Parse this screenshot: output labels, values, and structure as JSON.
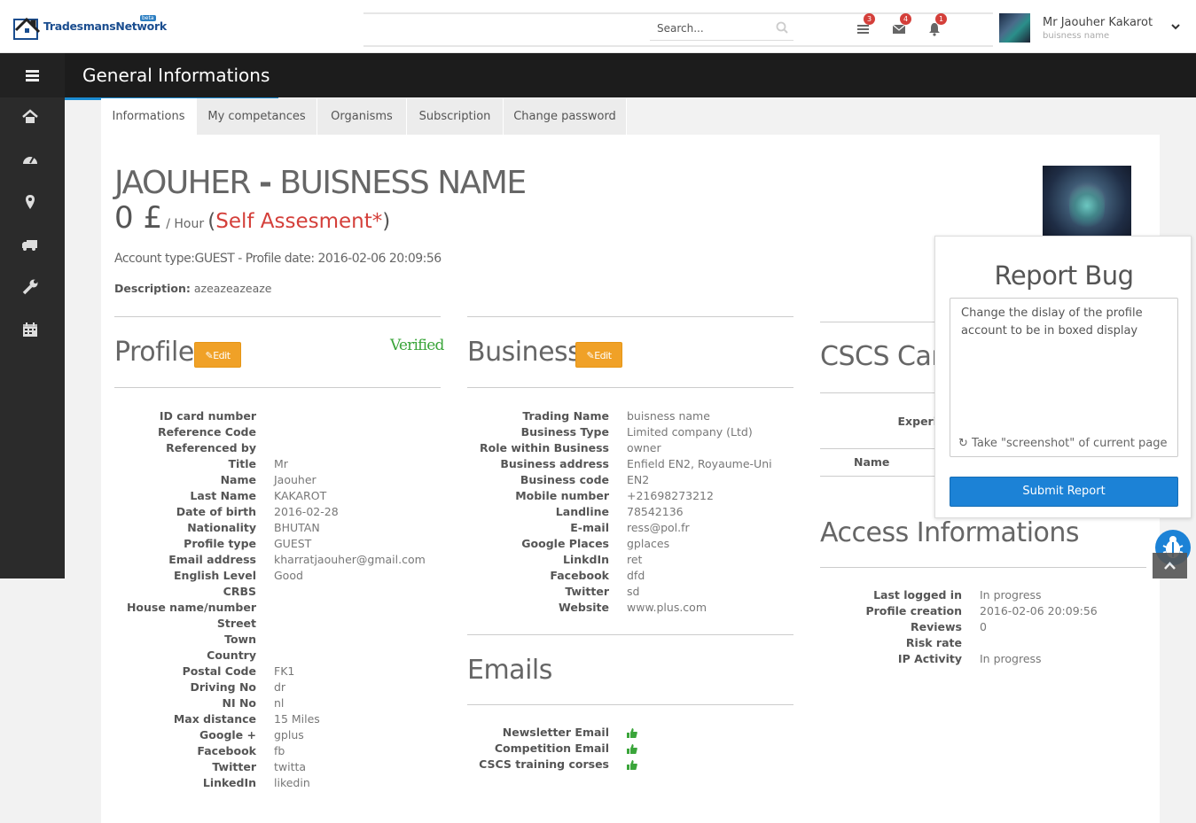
{
  "header": {
    "logo_text": "TradesmansNetwork",
    "logo_badge": "beta",
    "search_placeholder": "Search...",
    "badges": {
      "list": "3",
      "mail": "4",
      "bell": "1"
    },
    "user_name": "Mr Jaouher Kakarot",
    "user_sub": "buisness name"
  },
  "titlebar": {
    "title": "General Informations"
  },
  "sidebar": {
    "items": [
      "home-icon",
      "dashboard-icon",
      "map-marker-icon",
      "truck-icon",
      "wrench-icon",
      "calendar-icon"
    ]
  },
  "tabs": [
    "Informations",
    "My competances",
    "Organisms",
    "Subscription",
    "Change password"
  ],
  "summary": {
    "name_first": "JAOUHER",
    "name_sep": "-",
    "name_business": "BUISNESS NAME",
    "price_value": "0 £",
    "price_unit": "/ Hour",
    "price_open": "(",
    "price_note": "Self Assesment*",
    "price_close": ")",
    "account_line": "Account type:GUEST - Profile date: 2016-02-06 20:09:56",
    "desc_label": "Description:",
    "desc_value": "azeazeazeaze"
  },
  "profile": {
    "title": "Profile",
    "edit": "Edit",
    "verified": "Verified",
    "rows": [
      {
        "label": "ID card number",
        "value": ""
      },
      {
        "label": "Reference Code",
        "value": ""
      },
      {
        "label": "Referenced by",
        "value": ""
      },
      {
        "label": "Title",
        "value": "Mr"
      },
      {
        "label": "Name",
        "value": "Jaouher"
      },
      {
        "label": "Last Name",
        "value": "KAKAROT"
      },
      {
        "label": "Date of birth",
        "value": "2016-02-28"
      },
      {
        "label": "Nationality",
        "value": "BHUTAN"
      },
      {
        "label": "Profile type",
        "value": "GUEST"
      },
      {
        "label": "Email address",
        "value": "kharratjaouher@gmail.com"
      },
      {
        "label": "English Level",
        "value": "Good"
      },
      {
        "label": "CRBS",
        "value": ""
      },
      {
        "label": "House name/number",
        "value": ""
      },
      {
        "label": "Street",
        "value": ""
      },
      {
        "label": "Town",
        "value": ""
      },
      {
        "label": "Country",
        "value": ""
      },
      {
        "label": "Postal Code",
        "value": "FK1"
      },
      {
        "label": "Driving No",
        "value": "dr"
      },
      {
        "label": "NI No",
        "value": "nl"
      },
      {
        "label": "Max distance",
        "value": "15 Miles"
      },
      {
        "label": "Google +",
        "value": "gplus"
      },
      {
        "label": "Facebook",
        "value": "fb"
      },
      {
        "label": "Twitter",
        "value": "twitta"
      },
      {
        "label": "LinkedIn",
        "value": "likedin"
      }
    ]
  },
  "business": {
    "title": "Business",
    "edit": "Edit",
    "rows": [
      {
        "label": "Trading Name",
        "value": "buisness name"
      },
      {
        "label": "Business Type",
        "value": "Limited company (Ltd)"
      },
      {
        "label": "Role within Business",
        "value": "owner"
      },
      {
        "label": "Business address",
        "value": "Enfield EN2, Royaume-Uni"
      },
      {
        "label": "Business code",
        "value": "EN2"
      },
      {
        "label": "Mobile number",
        "value": "+21698273212"
      },
      {
        "label": "Landline",
        "value": "78542136"
      },
      {
        "label": "E-mail",
        "value": "ress@pol.fr"
      },
      {
        "label": "Google Places",
        "value": "gplaces"
      },
      {
        "label": "LinkdIn",
        "value": "ret"
      },
      {
        "label": "Facebook",
        "value": "dfd"
      },
      {
        "label": "Twitter",
        "value": "sd"
      },
      {
        "label": "Website",
        "value": "www.plus.com"
      }
    ]
  },
  "emails": {
    "title": "Emails",
    "rows": [
      "Newsletter Email",
      "Competition Email",
      "CSCS training corses"
    ]
  },
  "cscs": {
    "title": "CSCS Card",
    "experience_label": "Experi",
    "name_label": "Name"
  },
  "access": {
    "title": "Access Informations",
    "rows": [
      {
        "label": "Last logged in",
        "value": "In progress"
      },
      {
        "label": "Profile creation",
        "value": "2016-02-06 20:09:56"
      },
      {
        "label": "Reviews",
        "value": "0"
      },
      {
        "label": "Risk rate",
        "value": ""
      },
      {
        "label": "IP Activity",
        "value": "In progress"
      }
    ]
  },
  "report": {
    "title": "Report Bug",
    "text": "Change the dislay of the profile account to be in boxed display",
    "screenshot": "Take \"screenshot\" of current page",
    "submit": "Submit Report"
  },
  "colors": {
    "accent": "#1c82d6",
    "edit": "#f0a127",
    "verified": "#3aa53a",
    "danger": "#d43f3a",
    "titlebar": "#1c1c1c",
    "sidebar": "#2b2b2b"
  }
}
